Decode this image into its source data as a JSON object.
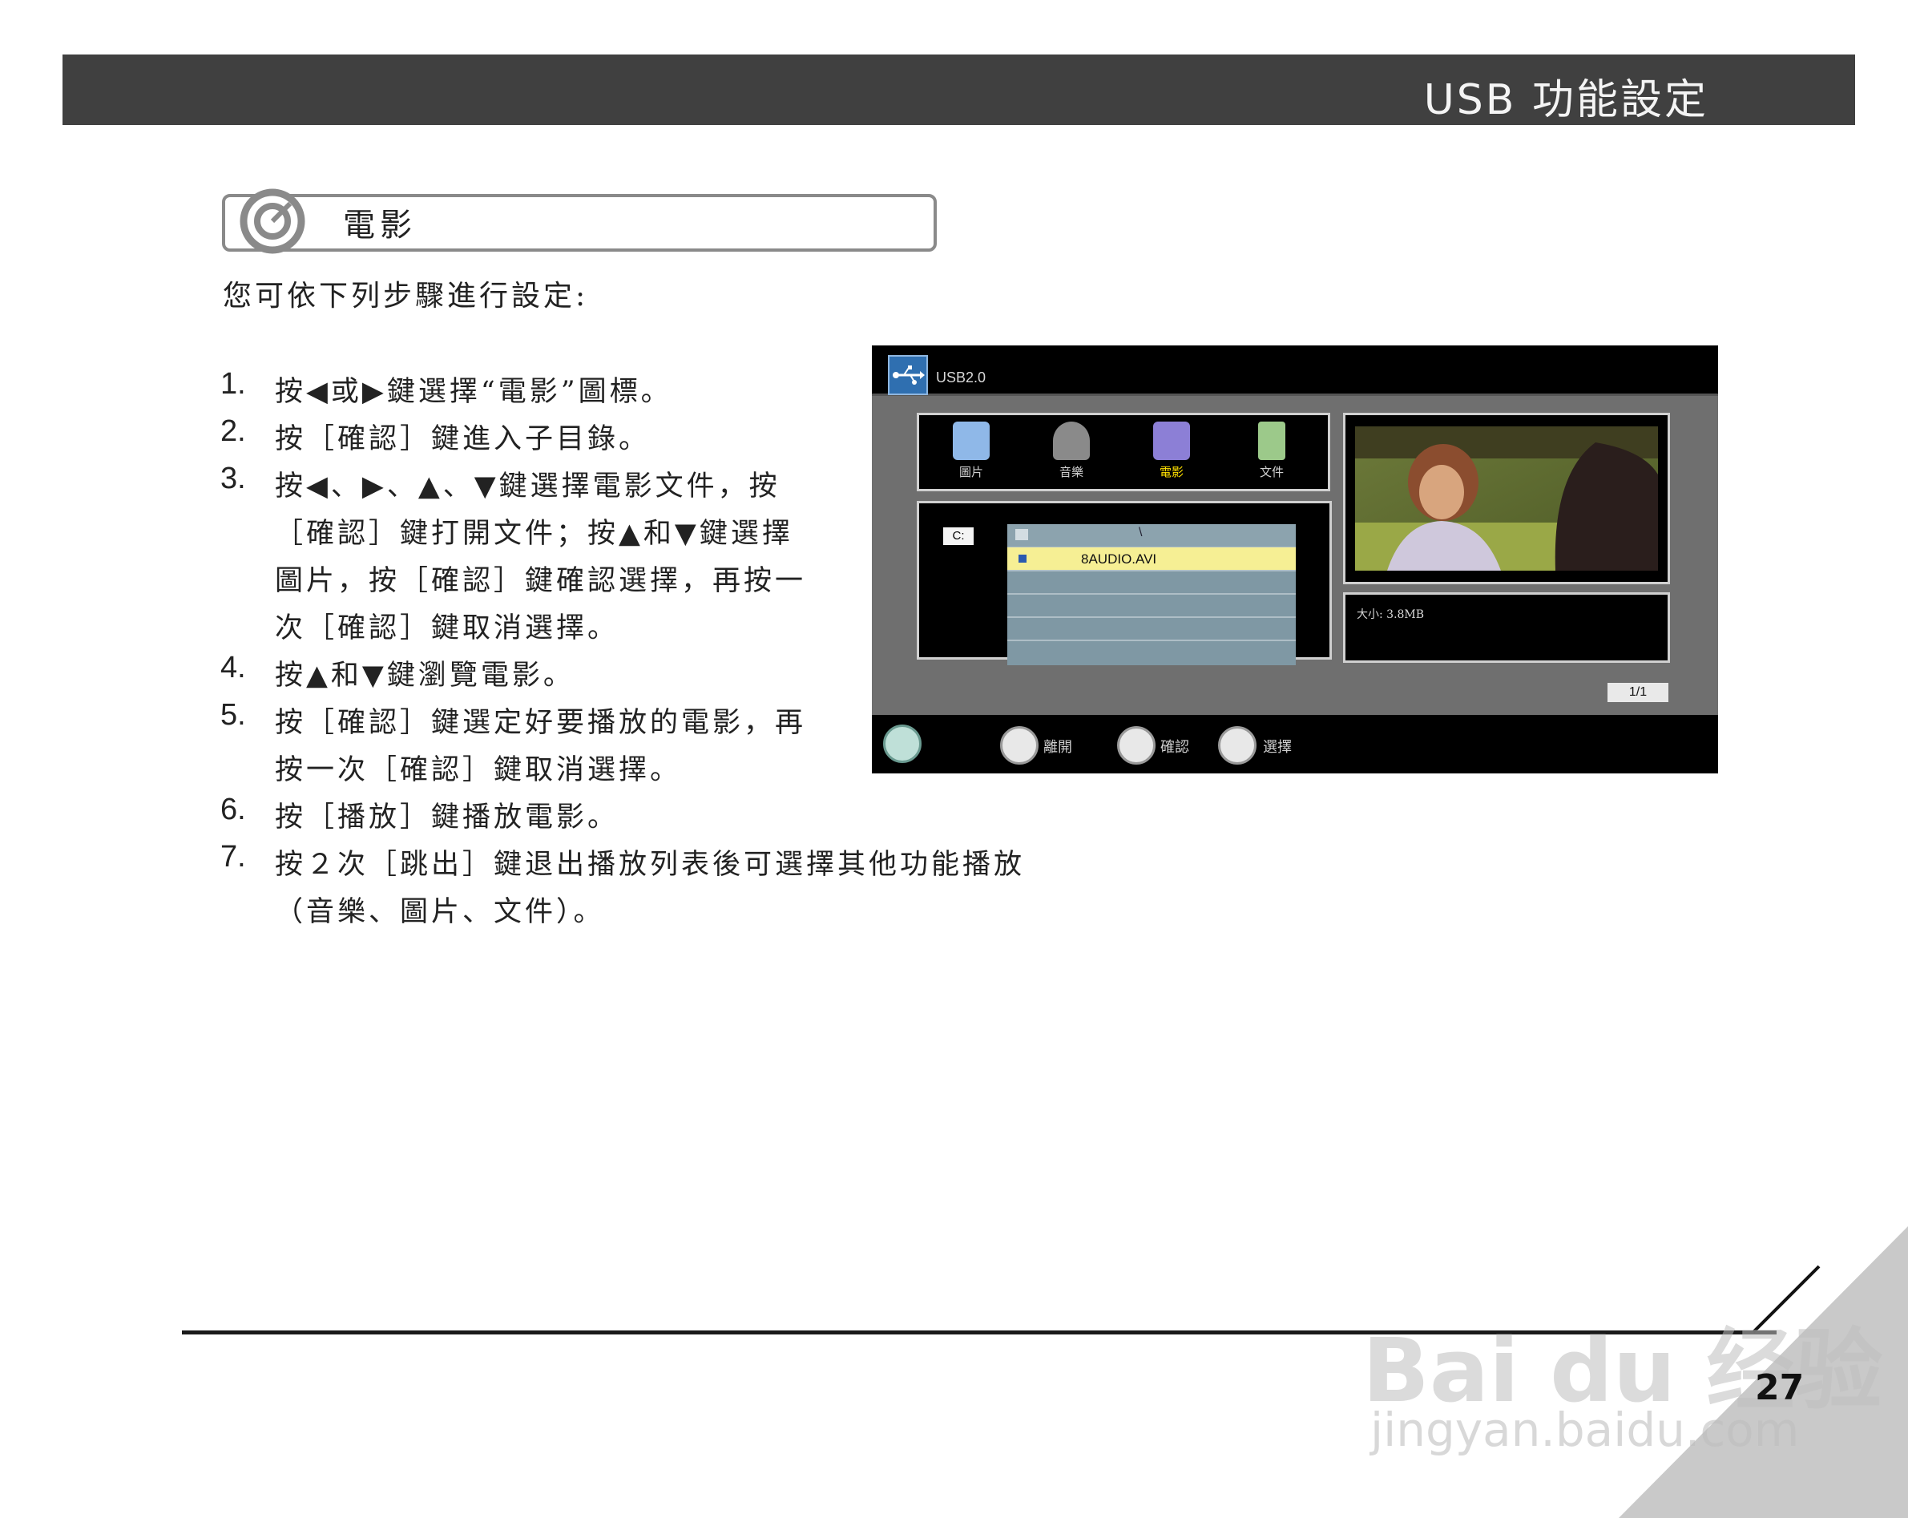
{
  "header": {
    "title": "USB 功能設定"
  },
  "section": {
    "title": "電影"
  },
  "intro": "您可依下列步驟進行設定:",
  "steps": [
    {
      "num": "1.",
      "lines": [
        "按◀或▶鍵選擇“電影”圖標。"
      ]
    },
    {
      "num": "2.",
      "lines": [
        "按［確認］鍵進入子目錄。"
      ]
    },
    {
      "num": "3.",
      "lines": [
        "按◀、▶、▲、▼鍵選擇電影文件，按",
        "［確認］鍵打開文件；按▲和▼鍵選擇",
        "圖片，按［確認］鍵確認選擇，再按一",
        "次［確認］鍵取消選擇。"
      ]
    },
    {
      "num": "4.",
      "lines": [
        "按▲和▼鍵瀏覽電影。"
      ]
    },
    {
      "num": "5.",
      "lines": [
        "按［確認］鍵選定好要播放的電影，再",
        "按一次［確認］鍵取消選擇。"
      ]
    },
    {
      "num": "6.",
      "lines": [
        "按［播放］鍵播放電影。"
      ]
    },
    {
      "num": "7.",
      "lines": [
        "按２次［跳出］鍵退出播放列表後可選擇其他功能播放",
        "（音樂、圖片、文件）。"
      ]
    }
  ],
  "screen": {
    "title": "USB2.0",
    "menu": [
      {
        "label": "圖片",
        "icon": "camera-icon",
        "color": "#8fb8e8"
      },
      {
        "label": "音樂",
        "icon": "headphones-icon",
        "color": "#8a8a8a"
      },
      {
        "label": "電影",
        "icon": "video-camera-icon",
        "color": "#8c7fd6",
        "active": true
      },
      {
        "label": "文件",
        "icon": "document-icon",
        "color": "#9cc98a"
      }
    ],
    "drive": "C:",
    "path": "\\",
    "files": [
      "8AUDIO.AVI"
    ],
    "info": "大小: 3.8MB",
    "page": "1/1",
    "hints": [
      {
        "label": "離開",
        "icon": "exit-icon"
      },
      {
        "label": "確認",
        "icon": "enter-icon"
      },
      {
        "label": "選擇",
        "icon": "updown-icon"
      }
    ]
  },
  "page_number": "27",
  "watermark": {
    "brand": "Bai du 经验",
    "url": "jingyan.baidu.com"
  },
  "colors": {
    "header_bg": "#404040",
    "screen_bg": "#000000",
    "selected_row": "#f6ef94",
    "active_label": "#ffe000"
  }
}
